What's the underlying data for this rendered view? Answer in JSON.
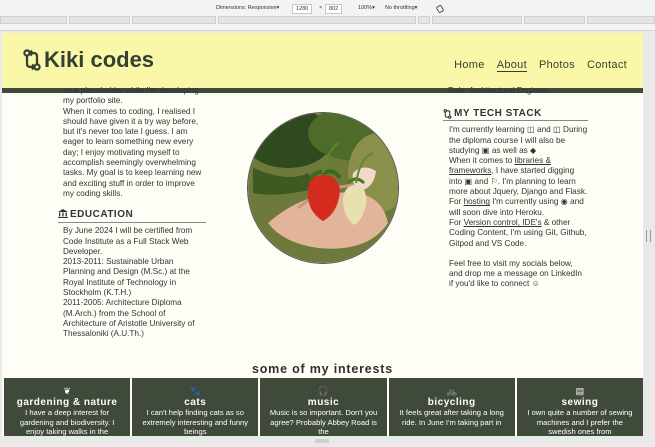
{
  "devtools": {
    "dimensions_label": "Dimensions: Responsive",
    "width_value": "1280",
    "times": "×",
    "height_value": "802",
    "zoom": "100%",
    "throttling": "No throttling",
    "caret": "▾"
  },
  "header": {
    "logo_text": "Kiki codes",
    "nav": [
      "Home",
      "About",
      "Photos",
      "Contact"
    ]
  },
  "left": {
    "intro_lines": [
      "as a placeholder while I'm developing",
      "my portfolio site."
    ],
    "intro_para": "When it comes to coding, I realised I should have given it a try way before, but it's never too late I guess. I am eager to learn something new every day; I enjoy motivating myself to accomplish seemingly overwhelming tasks. My goal is to keep learning new and exciting stuff in order to improve my coding skills.",
    "education_heading": "EDUCATION",
    "education": [
      "By June 2024 I will be certified from Code Institute as a Full Stack Web Developer.",
      "2013-2011: Sustainable Urban Planning and Design (M.Sc.) at the Royal Institute of Technology in Stockholm (K.T.H.)",
      "2011-2005: Architecture Diploma (M.Arch.) from the School of Architecture of Aristotle University of Thessaloniki (A.U.Th.)"
    ]
  },
  "right": {
    "role_line": "Role: Architectural Engineer.",
    "stack_heading": "MY TECH STACK",
    "s1": "I'm currently learning",
    "s2": "and",
    "s3": "During the diploma course I will also be studying",
    "s4": "as well as",
    "s5": "When it comes to",
    "s6": "libraries & frameworks",
    "s7": ", I have started digging into",
    "s8": "and",
    "s9": ". I'm planning to learn more about Jquery, Django and Flask.",
    "s10": "For",
    "s11": "hosting",
    "s12": "I'm currently using",
    "s13": "and will soon dive into Heroku.",
    "s14": "For",
    "s15": "Version control, IDE's",
    "s16": "& other Coding Content, I'm using Git, Github, Gitpod and VS Code.",
    "visit": "Feel free to visit my socials below, and drop me a message on LinkedIn if you'd like to connect",
    "smile": "☺"
  },
  "interests": {
    "title": "some of my interests",
    "cards": [
      {
        "icon": "❦",
        "title": "gardening & nature",
        "text": "I have a deep interest for gardening and biodiversity. I enjoy taking walks in the"
      },
      {
        "icon": "🐾",
        "title": "cats",
        "text": "I can't help finding cats as so extremely interesting and funny beings"
      },
      {
        "icon": "🎧",
        "title": "music",
        "text": "Music is so important. Don't you agree? Probably Abbey Road is the"
      },
      {
        "icon": "🚲",
        "title": "bicycling",
        "text": "It feels great after taking a long ride. In June I'm taking part in"
      },
      {
        "icon": "▤",
        "title": "sewing",
        "text": "I own quite a number of sewing machines and I prefer the swedish ones from"
      }
    ]
  },
  "colors": {
    "header_bg": "#faf7a8",
    "accent": "#3f4a3a",
    "page_bg": "#fefef6"
  }
}
